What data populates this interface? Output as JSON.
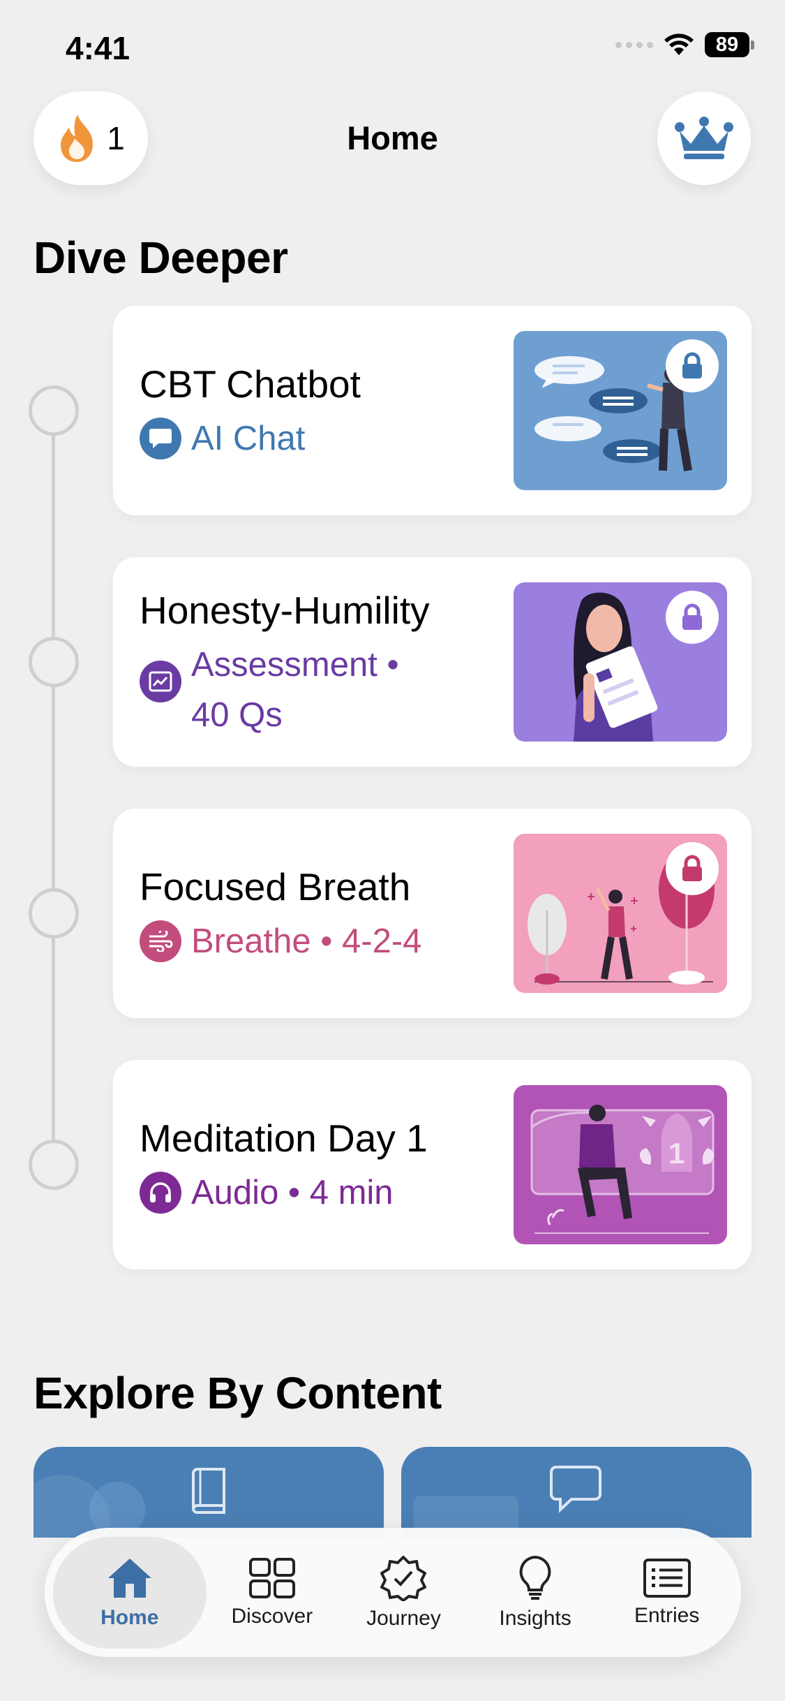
{
  "status_bar": {
    "time": "4:41",
    "battery": "89"
  },
  "header": {
    "title": "Home",
    "streak_count": "1"
  },
  "dive_deeper": {
    "title": "Dive Deeper",
    "cards": [
      {
        "title": "CBT Chatbot",
        "meta": "AI Chat",
        "icon": "chat-bubble-icon",
        "accent": "#3f78b0",
        "thumb_color": "#6f9fd1",
        "locked": true
      },
      {
        "title": "Honesty-Humility",
        "meta_line1": "Assessment •",
        "meta_line2": "40 Qs",
        "icon": "chart-icon",
        "accent": "#6a3ba3",
        "thumb_color": "#9b7fdf",
        "locked": true
      },
      {
        "title": "Focused Breath",
        "meta": "Breathe • 4-2-4",
        "icon": "wind-icon",
        "accent": "#c24d7d",
        "thumb_color": "#f2a0bd",
        "locked": true
      },
      {
        "title": "Meditation Day 1",
        "meta": "Audio • 4 min",
        "icon": "headphones-icon",
        "accent": "#7d2a94",
        "thumb_color": "#b154b5",
        "locked": false
      }
    ]
  },
  "explore": {
    "title": "Explore By Content"
  },
  "tabbar": {
    "items": [
      {
        "label": "Home",
        "icon": "home-icon",
        "active": true
      },
      {
        "label": "Discover",
        "icon": "grid-icon",
        "active": false
      },
      {
        "label": "Journey",
        "icon": "badge-check-icon",
        "active": false
      },
      {
        "label": "Insights",
        "icon": "lightbulb-icon",
        "active": false
      },
      {
        "label": "Entries",
        "icon": "list-icon",
        "active": false
      }
    ]
  }
}
